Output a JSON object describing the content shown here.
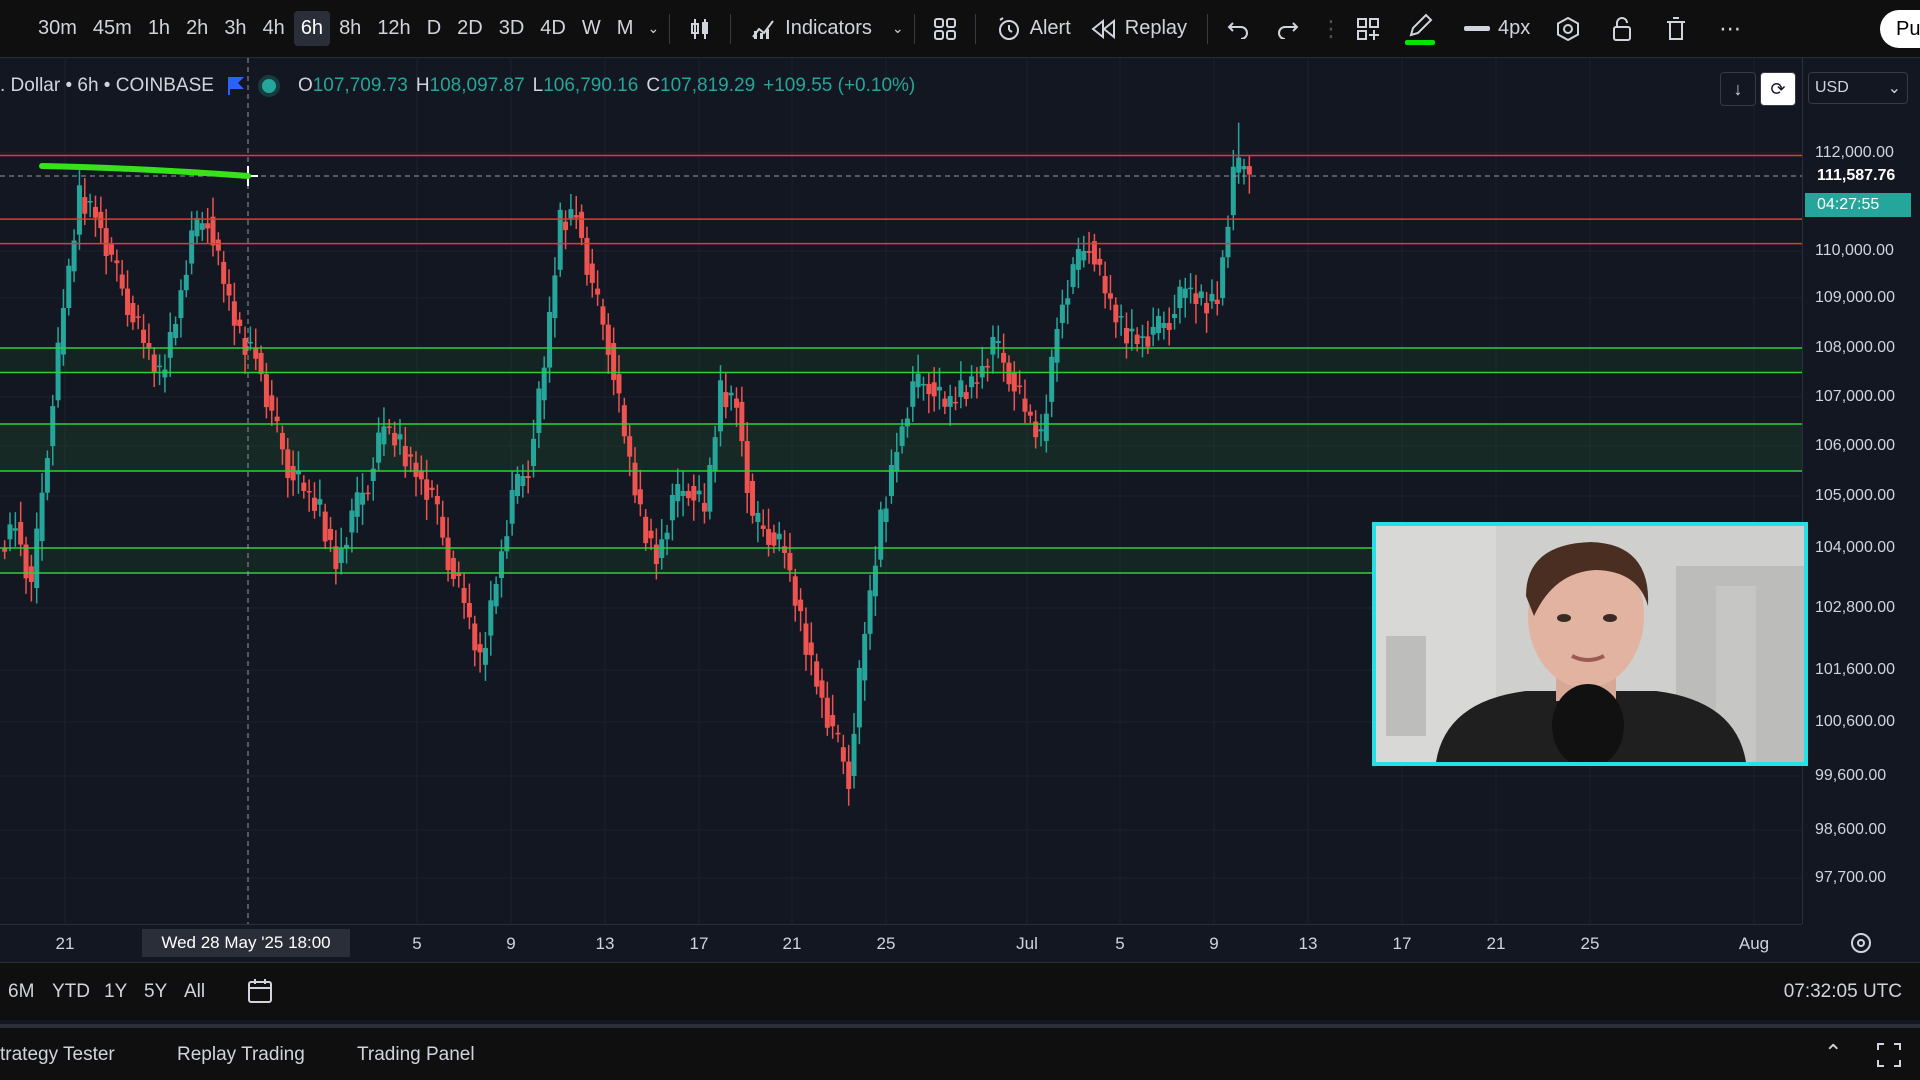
{
  "toolbar": {
    "timeframes": [
      "30m",
      "45m",
      "1h",
      "2h",
      "3h",
      "4h",
      "6h",
      "8h",
      "12h",
      "D",
      "2D",
      "3D",
      "4D",
      "W",
      "M"
    ],
    "active_timeframe": "6h",
    "indicators_label": "Indicators",
    "alert_label": "Alert",
    "replay_label": "Replay",
    "line_width_label": "4px",
    "publish_label": "Pu"
  },
  "legend": {
    "symbol": ". Dollar • 6h • COINBASE",
    "open_label": "O",
    "open": "107,709.73",
    "high_label": "H",
    "high": "108,097.87",
    "low_label": "L",
    "low": "106,790.16",
    "close_label": "C",
    "close": "107,819.29",
    "change": "+109.55 (+0.10%)"
  },
  "currency": "USD",
  "price_axis": {
    "ticks": [
      {
        "label": "112,000.00",
        "price": 112000
      },
      {
        "label": "110,000.00",
        "price": 110000
      },
      {
        "label": "109,000.00",
        "price": 109000
      },
      {
        "label": "108,000.00",
        "price": 108000
      },
      {
        "label": "107,000.00",
        "price": 107000
      },
      {
        "label": "106,000.00",
        "price": 106000
      },
      {
        "label": "105,000.00",
        "price": 105000
      },
      {
        "label": "104,000.00",
        "price": 104000
      },
      {
        "label": "102,800.00",
        "price": 102800
      },
      {
        "label": "101,600.00",
        "price": 101600
      },
      {
        "label": "100,600.00",
        "price": 100600
      },
      {
        "label": "99,600.00",
        "price": 99600
      },
      {
        "label": "98,600.00",
        "price": 98600
      },
      {
        "label": "97,700.00",
        "price": 97700
      }
    ],
    "crosshair_price": "111,587.76",
    "countdown": "04:27:55"
  },
  "time_axis": {
    "ticks": [
      "21",
      "5",
      "9",
      "13",
      "17",
      "21",
      "25",
      "Jul",
      "5",
      "9",
      "13",
      "17",
      "21",
      "25",
      "Aug"
    ],
    "crosshair_time": "Wed 28 May '25   18:00"
  },
  "range_bar": {
    "ranges": [
      "6M",
      "YTD",
      "1Y",
      "5Y",
      "All"
    ],
    "clock": "07:32:05 UTC"
  },
  "bottom_tabs": [
    "trategy Tester",
    "Replay Trading",
    "Trading Panel"
  ],
  "chart_data": {
    "type": "candlestick",
    "levels": {
      "resistance": [
        111950,
        110650,
        110150
      ],
      "support": [
        108000,
        107500,
        106450,
        105500,
        104000,
        103500
      ]
    },
    "candles_approx_close": [
      104500,
      103200,
      106000,
      108800,
      111100,
      110800,
      109800,
      108900,
      108100,
      107400,
      108600,
      110300,
      110700,
      109300,
      108200,
      107900,
      106600,
      105600,
      105100,
      104700,
      103700,
      104600,
      105300,
      106400,
      106000,
      105500,
      105000,
      103800,
      102900,
      101700,
      103400,
      105000,
      105600,
      107600,
      110600,
      110800,
      109200,
      108100,
      106200,
      104600,
      103800,
      104900,
      105200,
      104700,
      107100,
      106900,
      104500,
      104300,
      103900,
      102500,
      101400,
      100400,
      99600,
      102300,
      104500,
      106000,
      107200,
      107300,
      106800,
      107100,
      107400,
      108100,
      107500,
      106700,
      106100,
      108500,
      109600,
      110200,
      109100,
      108400,
      108200,
      108300,
      108600,
      109200,
      108900,
      109000,
      111600,
      111800
    ]
  },
  "colors": {
    "up": "#26a69a",
    "down": "#ef5350",
    "resistance": "#e53935",
    "support": "#2fcf3a",
    "drawing": "#37e21d",
    "webcam_border": "#27e0e6"
  }
}
